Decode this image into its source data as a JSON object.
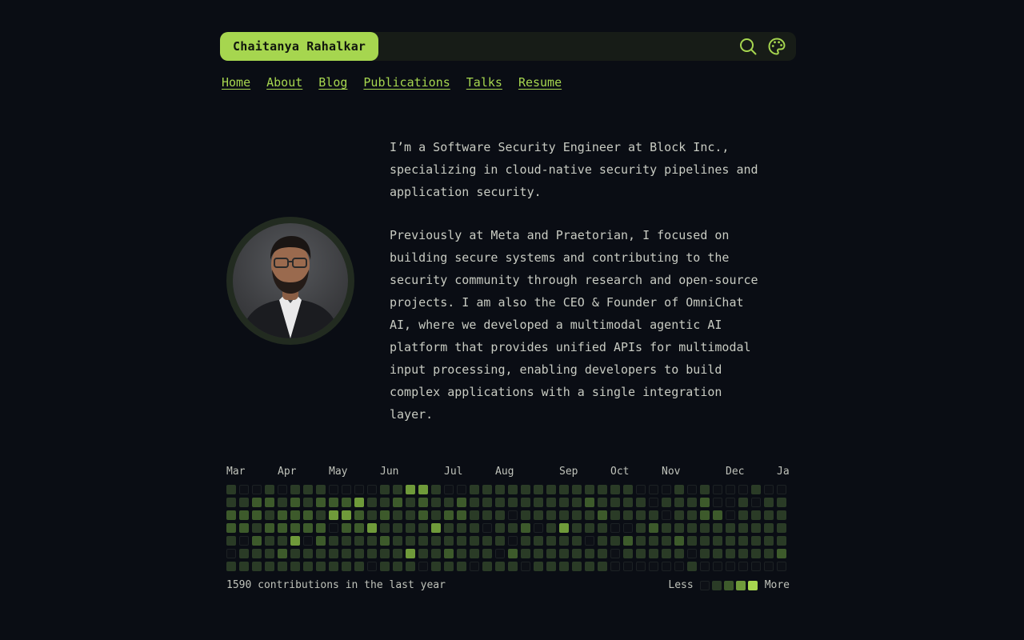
{
  "header": {
    "brand": "Chaitanya Rahalkar",
    "icons": [
      "search-icon",
      "palette-icon"
    ],
    "accent": "#a6d64f"
  },
  "nav": {
    "items": [
      {
        "label": "Home"
      },
      {
        "label": "About"
      },
      {
        "label": "Blog"
      },
      {
        "label": "Publications"
      },
      {
        "label": "Talks"
      },
      {
        "label": "Resume"
      }
    ]
  },
  "bio": {
    "paragraphs": [
      "I’m a Software Security Engineer at Block Inc., specializing in cloud-native security pipelines and application security.",
      "Previously at Meta and Praetorian, I focused on building secure systems and contributing to the security community through research and open-source projects. I am also the CEO & Founder of OmniChat AI, where we developed a multimodal agentic AI platform that provides unified APIs for multimodal input processing, enabling developers to build complex applications with a single integration layer."
    ]
  },
  "contributions": {
    "months": [
      "Mar",
      "Apr",
      "May",
      "Jun",
      "Jul",
      "Aug",
      "Sep",
      "Oct",
      "Nov",
      "Dec",
      "Ja"
    ],
    "month_week_index": [
      0,
      4,
      8,
      12,
      17,
      21,
      26,
      30,
      34,
      39,
      43
    ],
    "summary": "1590 contributions in the last year",
    "legend_less": "Less",
    "legend_more": "More",
    "level_colors": [
      "#0d1016",
      "#2a3b26",
      "#3d5a2b",
      "#6f9a3a",
      "#a6d64f"
    ],
    "weeks": [
      [
        1,
        1,
        2,
        2,
        1,
        0,
        1
      ],
      [
        0,
        1,
        2,
        2,
        0,
        1,
        1
      ],
      [
        0,
        2,
        2,
        1,
        2,
        1,
        1
      ],
      [
        1,
        2,
        1,
        2,
        1,
        1,
        1
      ],
      [
        0,
        1,
        2,
        2,
        1,
        2,
        1
      ],
      [
        1,
        2,
        2,
        2,
        3,
        1,
        1
      ],
      [
        1,
        1,
        2,
        2,
        0,
        1,
        1
      ],
      [
        1,
        2,
        1,
        2,
        2,
        1,
        1
      ],
      [
        0,
        2,
        3,
        0,
        1,
        1,
        1
      ],
      [
        0,
        2,
        3,
        2,
        1,
        1,
        1
      ],
      [
        0,
        3,
        2,
        2,
        1,
        1,
        1
      ],
      [
        0,
        1,
        1,
        3,
        1,
        1,
        0
      ],
      [
        1,
        1,
        2,
        1,
        2,
        1,
        1
      ],
      [
        1,
        2,
        1,
        1,
        1,
        1,
        1
      ],
      [
        3,
        1,
        1,
        1,
        1,
        3,
        1
      ],
      [
        3,
        2,
        2,
        1,
        1,
        1,
        0
      ],
      [
        1,
        1,
        1,
        3,
        1,
        1,
        1
      ],
      [
        0,
        1,
        2,
        1,
        1,
        2,
        1
      ],
      [
        0,
        2,
        2,
        1,
        1,
        1,
        1
      ],
      [
        1,
        1,
        1,
        1,
        1,
        1,
        0
      ],
      [
        1,
        1,
        1,
        0,
        1,
        1,
        1
      ],
      [
        1,
        1,
        1,
        1,
        1,
        0,
        1
      ],
      [
        1,
        1,
        0,
        1,
        0,
        2,
        1
      ],
      [
        1,
        1,
        1,
        2,
        1,
        1,
        0
      ],
      [
        1,
        1,
        1,
        0,
        1,
        1,
        1
      ],
      [
        1,
        1,
        1,
        1,
        1,
        1,
        1
      ],
      [
        1,
        1,
        1,
        3,
        1,
        1,
        1
      ],
      [
        1,
        1,
        1,
        1,
        1,
        1,
        1
      ],
      [
        1,
        2,
        1,
        1,
        0,
        1,
        1
      ],
      [
        1,
        1,
        2,
        1,
        1,
        1,
        1
      ],
      [
        1,
        1,
        1,
        0,
        1,
        0,
        0
      ],
      [
        1,
        1,
        1,
        0,
        2,
        1,
        0
      ],
      [
        0,
        1,
        1,
        1,
        1,
        1,
        0
      ],
      [
        0,
        0,
        1,
        2,
        1,
        1,
        0
      ],
      [
        0,
        1,
        0,
        1,
        1,
        1,
        0
      ],
      [
        1,
        1,
        1,
        1,
        2,
        1,
        0
      ],
      [
        0,
        1,
        1,
        1,
        1,
        0,
        1
      ],
      [
        1,
        2,
        2,
        1,
        1,
        1,
        0
      ],
      [
        0,
        0,
        2,
        1,
        1,
        1,
        0
      ],
      [
        0,
        0,
        0,
        1,
        1,
        1,
        0
      ],
      [
        0,
        1,
        1,
        1,
        1,
        1,
        0
      ],
      [
        1,
        0,
        1,
        1,
        1,
        1,
        0
      ],
      [
        0,
        1,
        1,
        1,
        1,
        1,
        0
      ],
      [
        0,
        1,
        1,
        1,
        1,
        2,
        0
      ]
    ]
  }
}
